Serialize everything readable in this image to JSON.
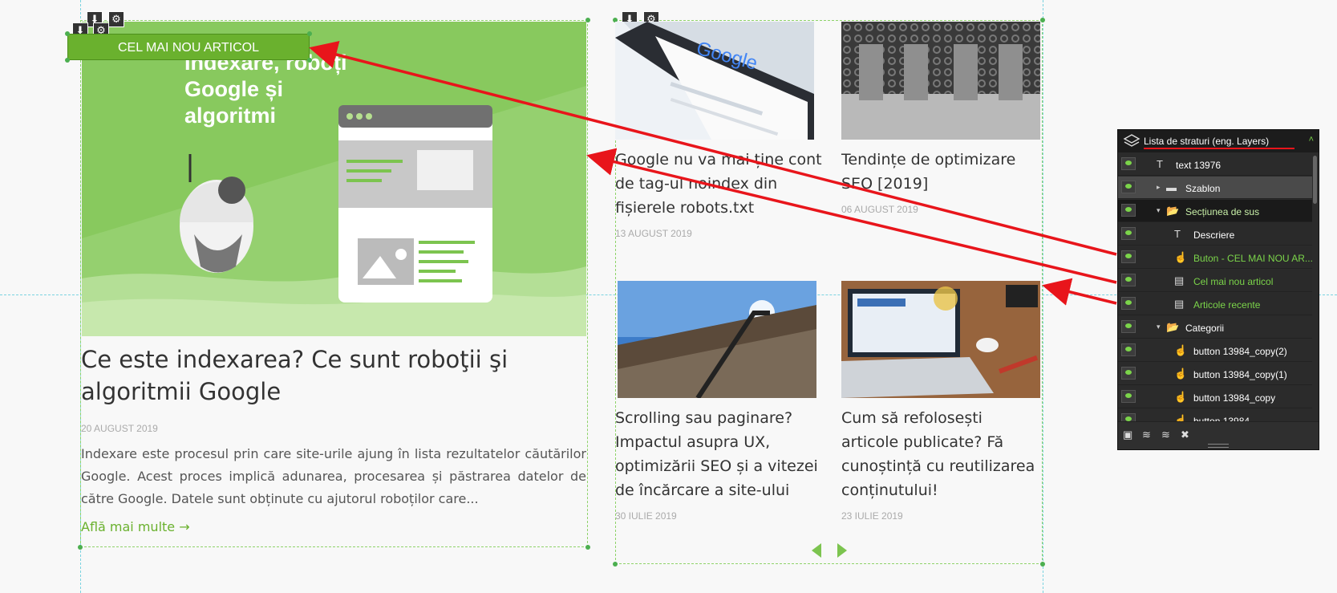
{
  "featured": {
    "badge": "CEL MAI NOU ARTICOL",
    "image_title": "Indexare, roboți Google și algoritmi",
    "title": "Ce este indexarea? Ce sunt roboţii şi algoritmii Google",
    "date": "20 AUGUST 2019",
    "excerpt": "Indexare este procesul prin care site-urile ajung în lista rezultatelor căutărilor Google. Acest proces implică adunarea, procesarea și păstrarea datelor de către Google. Datele sunt obținute cu ajutorul roboților care...",
    "more_link": "Află mai multe →"
  },
  "articles": [
    {
      "title": "Google nu va mai ține cont de tag-ul noindex din fișierele robots.txt",
      "date": "13 AUGUST 2019"
    },
    {
      "title": "Tendințe de optimizare SEO [2019]",
      "date": "06 AUGUST 2019"
    },
    {
      "title": "Scrolling sau paginare? Impactul asupra UX, optimizării SEO și a vitezei de încărcare a site-ului",
      "date": "30 IULIE 2019"
    },
    {
      "title": "Cum să refolosești articole publicate? Fă cunoștință cu reutilizarea conținutului!",
      "date": "23 IULIE 2019"
    }
  ],
  "layers_panel": {
    "title": "Lista de straturi (eng. Layers)",
    "rows": [
      {
        "label": "text 13976",
        "icon": "text-icon",
        "color": "#ffffff"
      },
      {
        "label": "Szablon",
        "icon": "template-icon",
        "color": "#ffffff"
      },
      {
        "label": "Secțiunea de sus",
        "icon": "folder-icon",
        "color": "#c8f0a8"
      },
      {
        "label": "Descriere",
        "icon": "text-icon",
        "color": "#ffffff"
      },
      {
        "label": "Buton - CEL MAI NOU AR...",
        "icon": "pointer-icon",
        "color": "#7bd44a"
      },
      {
        "label": "Cel mai nou articol",
        "icon": "widget-icon",
        "color": "#7bd44a"
      },
      {
        "label": "Articole recente",
        "icon": "widget-icon",
        "color": "#7bd44a"
      },
      {
        "label": "Categorii",
        "icon": "folder-icon",
        "color": "#ffffff"
      },
      {
        "label": "button 13984_copy(2)",
        "icon": "pointer-icon",
        "color": "#ffffff"
      },
      {
        "label": "button 13984_copy(1)",
        "icon": "pointer-icon",
        "color": "#ffffff"
      },
      {
        "label": "button 13984_copy",
        "icon": "pointer-icon",
        "color": "#ffffff"
      },
      {
        "label": "button 13984",
        "icon": "pointer-icon",
        "color": "#ffffff"
      }
    ]
  },
  "colors": {
    "accent": "#6ab12e",
    "annotation": "#e8151b"
  }
}
